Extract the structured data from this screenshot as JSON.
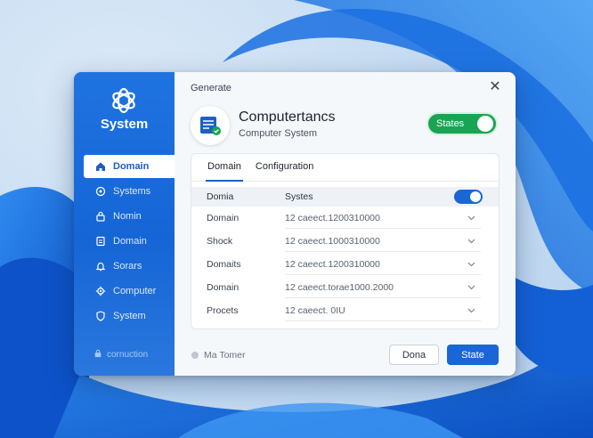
{
  "sidebar": {
    "brand": "System",
    "items": [
      {
        "label": "Domain",
        "icon": "home-icon",
        "active": true
      },
      {
        "label": "Systems",
        "icon": "circle-icon"
      },
      {
        "label": "Nomin",
        "icon": "lock-icon"
      },
      {
        "label": "Domain",
        "icon": "document-icon"
      },
      {
        "label": "Sorars",
        "icon": "bell-icon"
      },
      {
        "label": "Computer",
        "icon": "gear-icon"
      },
      {
        "label": "System",
        "icon": "shield-icon"
      }
    ],
    "footer": "cornuction"
  },
  "dialog": {
    "title": "Generate",
    "app_name": "Computertancs",
    "app_subtitle": "Computer System",
    "status_label": "States",
    "status_on": true
  },
  "tabs": [
    "Domain",
    "Configuration"
  ],
  "table": {
    "header": {
      "c1": "Domia",
      "c2": "Systes",
      "toggle_on": true
    },
    "rows": [
      {
        "label": "Domain",
        "value": "12 caeect.1200310000"
      },
      {
        "label": "Shock",
        "value": "12 caeect.1000310000"
      },
      {
        "label": "Domaits",
        "value": "12 caeect.1200310000"
      },
      {
        "label": "Domain",
        "value": "12 caeect.torae1000.2000"
      },
      {
        "label": "Procets",
        "value": "12 caeect. 0IU"
      }
    ]
  },
  "footer": {
    "status": "Ma Tomer",
    "secondary_button": "Dona",
    "primary_button": "State"
  },
  "colors": {
    "accent": "#1b66d6",
    "sidebar": "#1f73e0",
    "status_green": "#19a453"
  }
}
